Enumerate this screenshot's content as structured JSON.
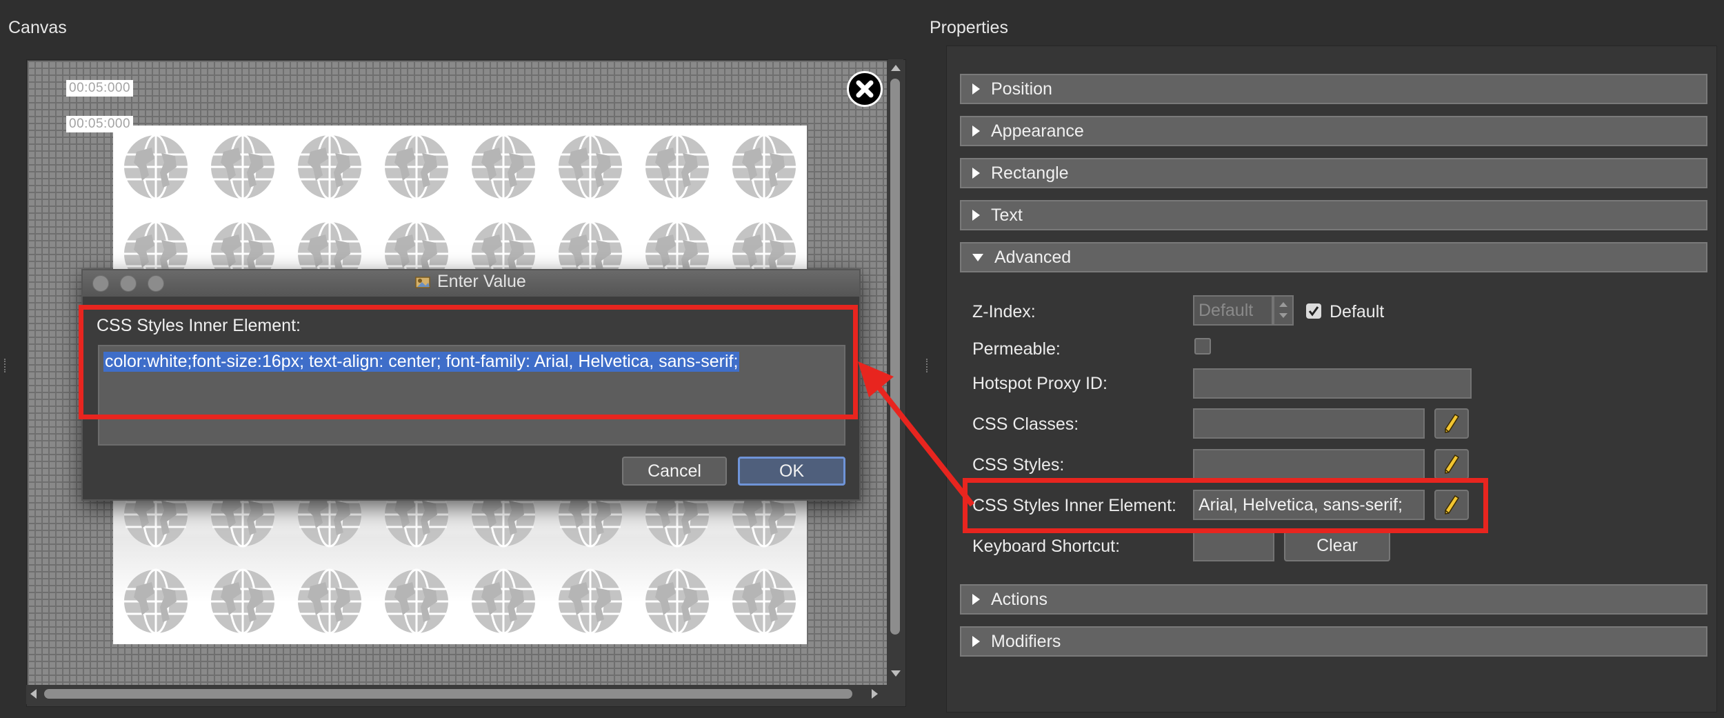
{
  "canvas_panel": {
    "title": "Canvas",
    "timecodes": [
      "00:05:000",
      "00:05:000"
    ]
  },
  "properties_panel": {
    "title": "Properties",
    "sections_top": [
      {
        "label": "Position",
        "expanded": false
      },
      {
        "label": "Appearance",
        "expanded": false
      },
      {
        "label": "Rectangle",
        "expanded": false
      },
      {
        "label": "Text",
        "expanded": false
      },
      {
        "label": "Advanced",
        "expanded": true
      }
    ],
    "advanced": {
      "z_index_label": "Z-Index:",
      "z_index_placeholder": "Default",
      "z_index_default_checkbox_label": "Default",
      "z_index_default_checked": true,
      "permeable_label": "Permeable:",
      "permeable_checked": false,
      "hotspot_proxy_label": "Hotspot Proxy ID:",
      "hotspot_proxy_value": "",
      "css_classes_label": "CSS Classes:",
      "css_classes_value": "",
      "css_styles_label": "CSS Styles:",
      "css_styles_value": "",
      "css_inner_label": "CSS Styles Inner Element:",
      "css_inner_value": "Arial, Helvetica, sans-serif;",
      "keyboard_shortcut_label": "Keyboard Shortcut:",
      "keyboard_shortcut_value": "",
      "clear_label": "Clear"
    },
    "sections_bottom": [
      {
        "label": "Actions",
        "expanded": false
      },
      {
        "label": "Modifiers",
        "expanded": false
      }
    ]
  },
  "dialog": {
    "title": "Enter Value",
    "field_label": "CSS Styles Inner Element:",
    "value": "color:white;font-size:16px; text-align: center; font-family: Arial, Helvetica, sans-serif;",
    "cancel_label": "Cancel",
    "ok_label": "OK"
  },
  "colors": {
    "annotation_red": "#e8251f",
    "selection_blue": "#3f6ec9",
    "ok_border": "#6f94d8"
  }
}
